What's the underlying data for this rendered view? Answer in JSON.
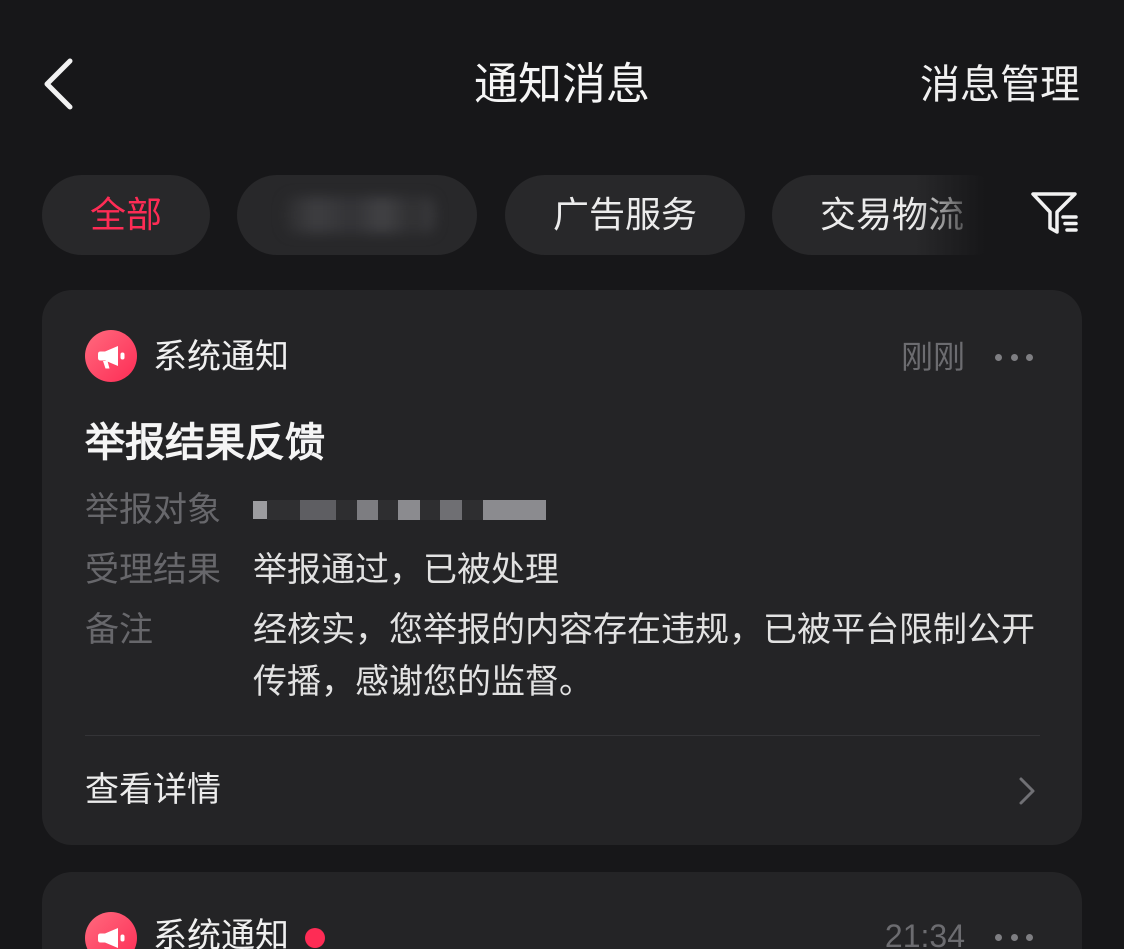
{
  "header": {
    "title": "通知消息",
    "manage_label": "消息管理"
  },
  "tabs": [
    {
      "label": "全部",
      "active": true
    },
    {
      "blurred": true
    },
    {
      "label": "广告服务"
    },
    {
      "label": "交易物流"
    }
  ],
  "notifications": [
    {
      "source": "系统通知",
      "time": "刚刚",
      "title": "举报结果反馈",
      "fields": [
        {
          "label": "举报对象",
          "redacted": true
        },
        {
          "label": "受理结果",
          "value": "举报通过，已被处理"
        },
        {
          "label": "备注",
          "value": "经核实，您举报的内容存在违规，已被平台限制公开传播，感谢您的监督。"
        }
      ],
      "action_label": "查看详情"
    },
    {
      "source": "系统通知",
      "time": "21:34",
      "unread": true
    }
  ],
  "icons": {
    "back": "chevron-left-icon",
    "filter": "filter-icon",
    "source": "megaphone-icon",
    "more": "more-dots-icon",
    "detail_arrow": "chevron-right-icon"
  },
  "colors": {
    "accent": "#fe2c55",
    "background": "#171719",
    "card": "#242426",
    "chip": "#28282a",
    "muted_text": "#6c6c70"
  }
}
